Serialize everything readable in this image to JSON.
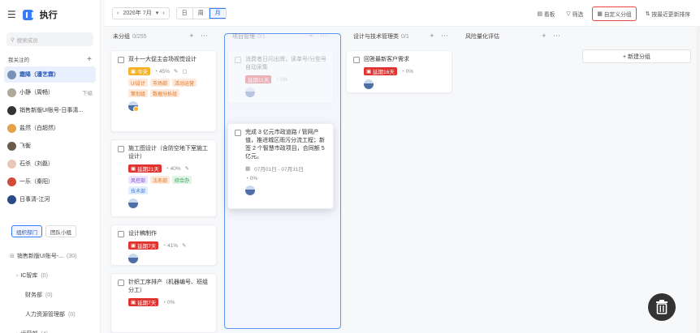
{
  "app": {
    "title": "执行"
  },
  "sidebar": {
    "search_placeholder": "搜索成员",
    "section_title": "我关注的",
    "users": [
      {
        "name": "霜降（潘艺霖）",
        "extra": "",
        "active": true,
        "color": "#7890b8"
      },
      {
        "name": "小静（周畅）",
        "extra": "下级",
        "active": false,
        "color": "#b0a89a"
      },
      {
        "name": "销售新版UI账号-日事清...",
        "extra": "",
        "active": false,
        "color": "#333333"
      },
      {
        "name": "盐然（白超然）",
        "extra": "",
        "active": false,
        "color": "#e6a24a"
      },
      {
        "name": "飞衡",
        "extra": "",
        "active": false,
        "color": "#6b5a4a"
      },
      {
        "name": "石杀（刘磊）",
        "extra": "",
        "active": false,
        "color": "#e8c7b8"
      },
      {
        "name": "一乐（秦阳）",
        "extra": "",
        "active": false,
        "color": "#d24a3a"
      },
      {
        "name": "日事清-江河",
        "extra": "",
        "active": false,
        "color": "#2b4a8a"
      }
    ],
    "toggle": {
      "org": "组织部门",
      "team": "团队小组"
    },
    "org_tree": [
      {
        "label": "销售新版UI账号-...",
        "count": "(30)",
        "indent": 12
      },
      {
        "label": "IC智库",
        "count": "(0)",
        "indent": 20
      },
      {
        "label": "财务部",
        "count": "(0)",
        "indent": 28
      },
      {
        "label": "人力资源管理部",
        "count": "(0)",
        "indent": 28
      },
      {
        "label": "运营部",
        "count": "(4)",
        "indent": 20
      }
    ]
  },
  "toolbar": {
    "date": "2026年 7月",
    "views": [
      "日",
      "周",
      "月"
    ],
    "actions": [
      {
        "label": "看板",
        "icon": "board-icon"
      },
      {
        "label": "筛选",
        "icon": "filter-icon"
      },
      {
        "label": "自定义分组",
        "icon": "custom-group-icon"
      },
      {
        "label": "按最近更新排序",
        "icon": "sort-icon"
      }
    ]
  },
  "columns": [
    {
      "title": "未分组",
      "count": "0/255"
    },
    {
      "title": "项目管理",
      "count": "0/1"
    },
    {
      "title": "设计与技术管理类",
      "count": "0/1"
    },
    {
      "title": "风险量化评估",
      "count": ""
    }
  ],
  "new_group_label": "+ 新建分组",
  "cards": {
    "c1": {
      "title": "双十一大促主会场视觉设计",
      "badge": "今天",
      "progress": "45%",
      "tags": [
        "UI设计",
        "市场部",
        "活动运营",
        "策划组",
        "数据分析组"
      ]
    },
    "c2": {
      "title": "施工图设计（含防空地下室施工设计）",
      "badge": "延期21天",
      "progress": "40%",
      "tags": [
        "风控部",
        "法务部",
        "综合办",
        "技术部"
      ]
    },
    "c3": {
      "title": "设计稿制作",
      "badge": "延期7天",
      "progress": "41%"
    },
    "c4": {
      "title": "针织工序排产（机器编号、班组分工）",
      "badge": "延期7天",
      "progress": "0%"
    },
    "ghost": {
      "title": "消费者日问出牌，读单号/分型号自动采集",
      "badge": "延期11天",
      "progress": "0%"
    },
    "drag": {
      "title": "完成 3 亿元市政道路 / 管网产值，推进城区雨污分流工程；新签 2 个智慧市政项目，合同额 5 亿元。",
      "dates": "07月01日 - 07月31日",
      "progress": "0%"
    },
    "c5": {
      "title": "回答最新客户需求",
      "badge": "延期16天",
      "progress": "0%"
    }
  },
  "colors": {
    "accent": "#3a7bf6",
    "overdue": "#e0322e",
    "today": "#f7b22b"
  }
}
